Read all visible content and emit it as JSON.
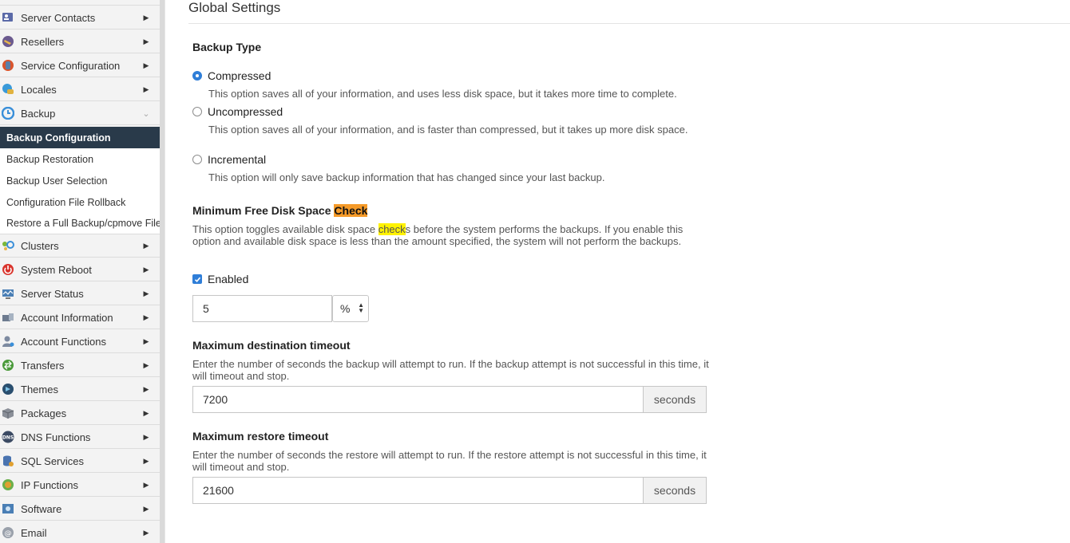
{
  "sidebar": {
    "items_top": [
      {
        "label": "Server Contacts",
        "icon": "contacts-icon"
      },
      {
        "label": "Resellers",
        "icon": "resellers-icon"
      },
      {
        "label": "Service Configuration",
        "icon": "service-config-icon"
      },
      {
        "label": "Locales",
        "icon": "locales-icon"
      },
      {
        "label": "Backup",
        "icon": "backup-icon"
      }
    ],
    "backup_sub": [
      {
        "label": "Backup Configuration",
        "active": true
      },
      {
        "label": "Backup Restoration"
      },
      {
        "label": "Backup User Selection"
      },
      {
        "label": "Configuration File Rollback"
      },
      {
        "label": "Restore a Full Backup/cpmove File"
      }
    ],
    "items_bottom": [
      {
        "label": "Clusters",
        "icon": "clusters-icon"
      },
      {
        "label": "System Reboot",
        "icon": "reboot-icon"
      },
      {
        "label": "Server Status",
        "icon": "server-status-icon"
      },
      {
        "label": "Account Information",
        "icon": "account-info-icon"
      },
      {
        "label": "Account Functions",
        "icon": "account-functions-icon"
      },
      {
        "label": "Transfers",
        "icon": "transfers-icon"
      },
      {
        "label": "Themes",
        "icon": "themes-icon"
      },
      {
        "label": "Packages",
        "icon": "packages-icon"
      },
      {
        "label": "DNS Functions",
        "icon": "dns-icon"
      },
      {
        "label": "SQL Services",
        "icon": "sql-icon"
      },
      {
        "label": "IP Functions",
        "icon": "ip-icon"
      },
      {
        "label": "Software",
        "icon": "software-icon"
      },
      {
        "label": "Email",
        "icon": "email-icon"
      }
    ],
    "dns_icon_text": "DNS",
    "arrow_right": "▶",
    "arrow_down": "⌄"
  },
  "main": {
    "title": "Global Settings",
    "backup_type": {
      "heading": "Backup Type",
      "options": [
        {
          "label": "Compressed",
          "checked": true,
          "desc": "This option saves all of your information, and uses less disk space, but it takes more time to complete."
        },
        {
          "label": "Uncompressed",
          "checked": false,
          "desc": "This option saves all of your information, and is faster than compressed, but it takes up more disk space."
        },
        {
          "label": "Incremental",
          "checked": false,
          "desc": "This option will only save backup information that has changed since your last backup."
        }
      ]
    },
    "min_free": {
      "heading_pre": "Minimum Free Disk Space ",
      "heading_hl": "Check",
      "desc_pre": "This option toggles available disk space ",
      "desc_hl": "check",
      "desc_post": "s before the system performs the backups. If you enable this option and available disk space is less than the amount specified, the system will not perform the backups.",
      "enabled_label": "Enabled",
      "enabled": true,
      "value": "5",
      "unit": "%"
    },
    "dest_timeout": {
      "heading": "Maximum destination timeout",
      "desc": "Enter the number of seconds the backup will attempt to run. If the backup attempt is not successful in this time, it will timeout and stop.",
      "value": "7200",
      "unit": "seconds"
    },
    "restore_timeout": {
      "heading": "Maximum restore timeout",
      "desc": "Enter the number of seconds the restore will attempt to run. If the restore attempt is not successful in this time, it will timeout and stop.",
      "value": "21600",
      "unit": "seconds"
    }
  },
  "colors": {
    "accent": "#2f7ed8",
    "active_nav": "#293a4a",
    "highlight_orange": "#f59a28",
    "highlight_yellow": "#fff200"
  }
}
